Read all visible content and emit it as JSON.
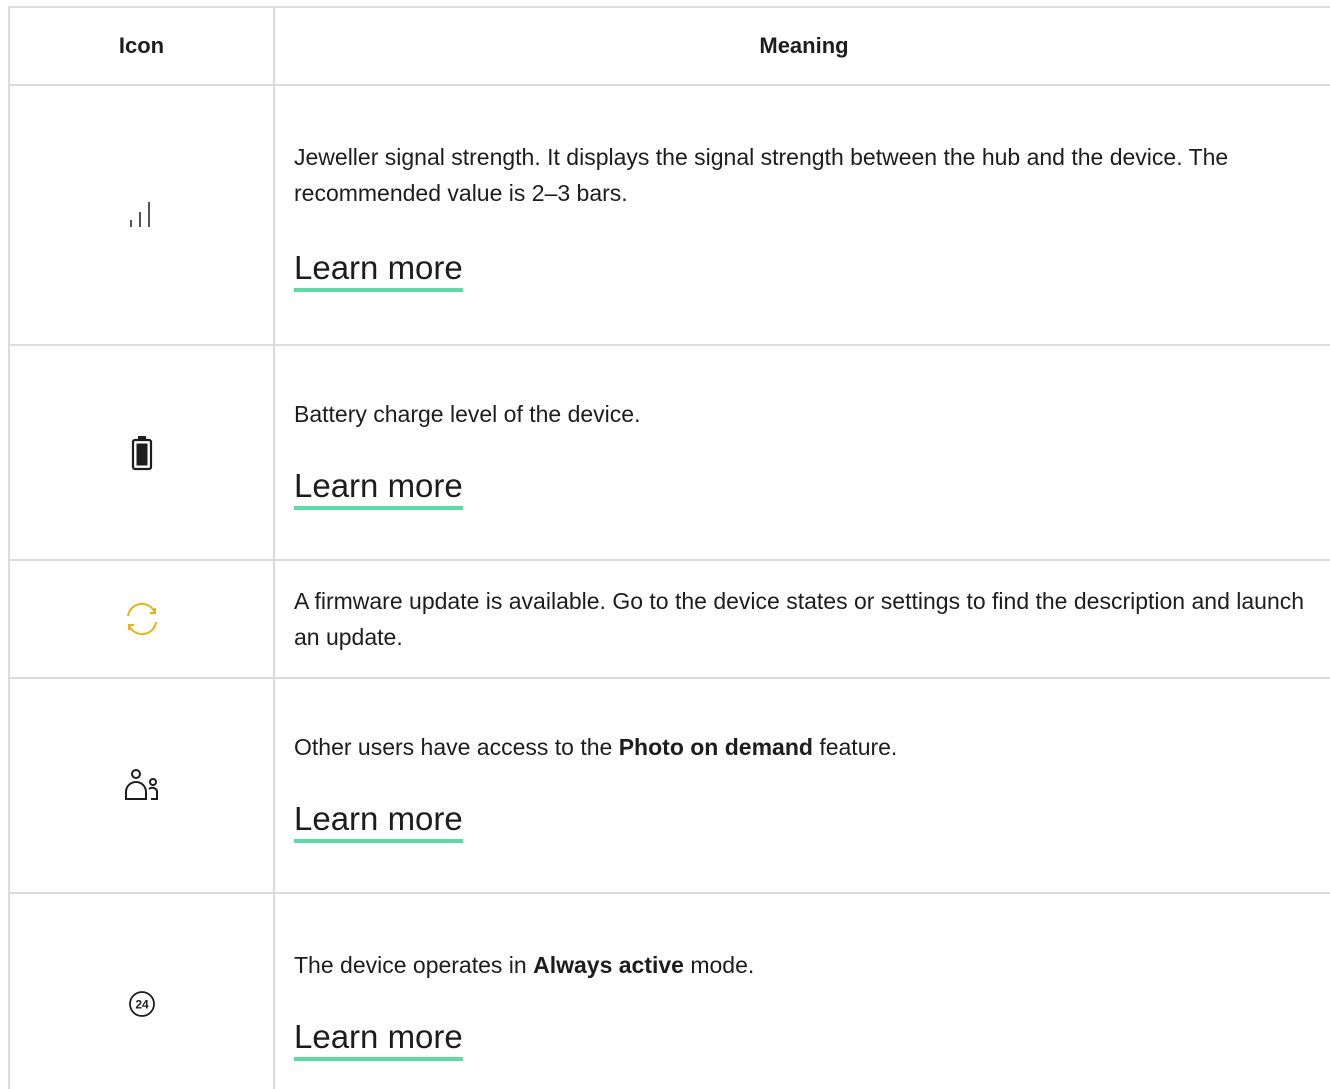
{
  "table": {
    "headers": {
      "icon": "Icon",
      "meaning": "Meaning"
    },
    "rows": [
      {
        "icon": "signal-strength-icon",
        "text": "Jeweller signal strength. It displays the signal strength between the hub and the device. The recommended value is 2–3 bars.",
        "link": "Learn more"
      },
      {
        "icon": "battery-icon",
        "text": "Battery charge level of the device.",
        "link": "Learn more"
      },
      {
        "icon": "firmware-update-icon",
        "text": "A firmware update is available. Go to the device states or settings to find the description and launch an update.",
        "icon_color": "#e8b21a"
      },
      {
        "icon": "users-access-icon",
        "text_before": "Other users have access to the ",
        "text_bold": "Photo on demand",
        "text_after": " feature.",
        "link": "Learn more"
      },
      {
        "icon": "always-active-24-icon",
        "icon_label": "24",
        "text_before": "The device operates in ",
        "text_bold": "Always active",
        "text_after": " mode.",
        "link": "Learn more"
      }
    ]
  },
  "colors": {
    "link_underline": "#5fdaa4",
    "border": "#dcdcdc",
    "update_icon": "#e8b21a"
  }
}
